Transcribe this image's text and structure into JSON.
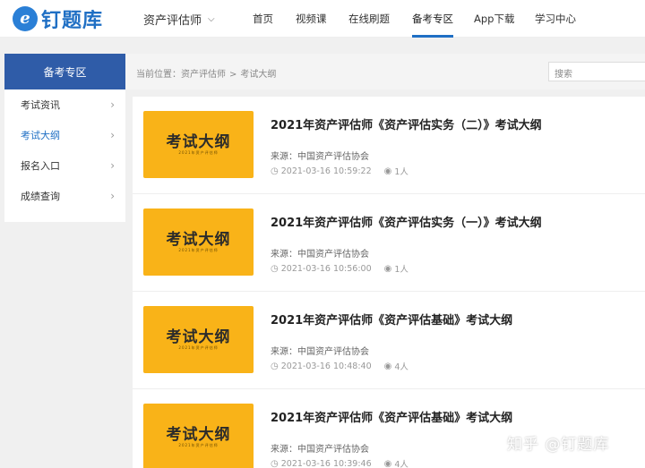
{
  "header": {
    "logo_text": "钉题库",
    "exam_select": "资产评估师",
    "nav": [
      {
        "label": "首页"
      },
      {
        "label": "视频课"
      },
      {
        "label": "在线刷题"
      },
      {
        "label": "备考专区"
      },
      {
        "label": "App下载"
      },
      {
        "label": "学习中心"
      }
    ]
  },
  "sidebar": {
    "title": "备考专区",
    "items": [
      {
        "label": "考试资讯"
      },
      {
        "label": "考试大纲"
      },
      {
        "label": "报名入口"
      },
      {
        "label": "成绩查询"
      }
    ]
  },
  "breadcrumb": {
    "prefix": "当前位置：",
    "level1": "资产评估师",
    "sep": ">",
    "level2": "考试大纲"
  },
  "search": {
    "placeholder": "搜索"
  },
  "articles": [
    {
      "thumb_title": "考试大纲",
      "thumb_sub": "2021年资产评估师",
      "title": "2021年资产评估师《资产评估实务（二）》考试大纲",
      "source": "来源：中国资产评估协会",
      "time": "2021-03-16 10:59:22",
      "views": "1人"
    },
    {
      "thumb_title": "考试大纲",
      "thumb_sub": "2021年资产评估师",
      "title": "2021年资产评估师《资产评估实务（一）》考试大纲",
      "source": "来源：中国资产评估协会",
      "time": "2021-03-16 10:56:00",
      "views": "1人"
    },
    {
      "thumb_title": "考试大纲",
      "thumb_sub": "2021年资产评估师",
      "title": "2021年资产评估师《资产评估基础》考试大纲",
      "source": "来源：中国资产评估协会",
      "time": "2021-03-16 10:48:40",
      "views": "4人"
    },
    {
      "thumb_title": "考试大纲",
      "thumb_sub": "2021年资产评估师",
      "title": "2021年资产评估师《资产评估基础》考试大纲",
      "source": "来源：中国资产评估协会",
      "time": "2021-03-16 10:39:46",
      "views": "4人"
    }
  ],
  "watermark": "知乎 @钉题库",
  "colors": {
    "brand": "#1f6fc4",
    "sidebar_head": "#2f5ca8",
    "thumb_bg": "#f9b318"
  }
}
